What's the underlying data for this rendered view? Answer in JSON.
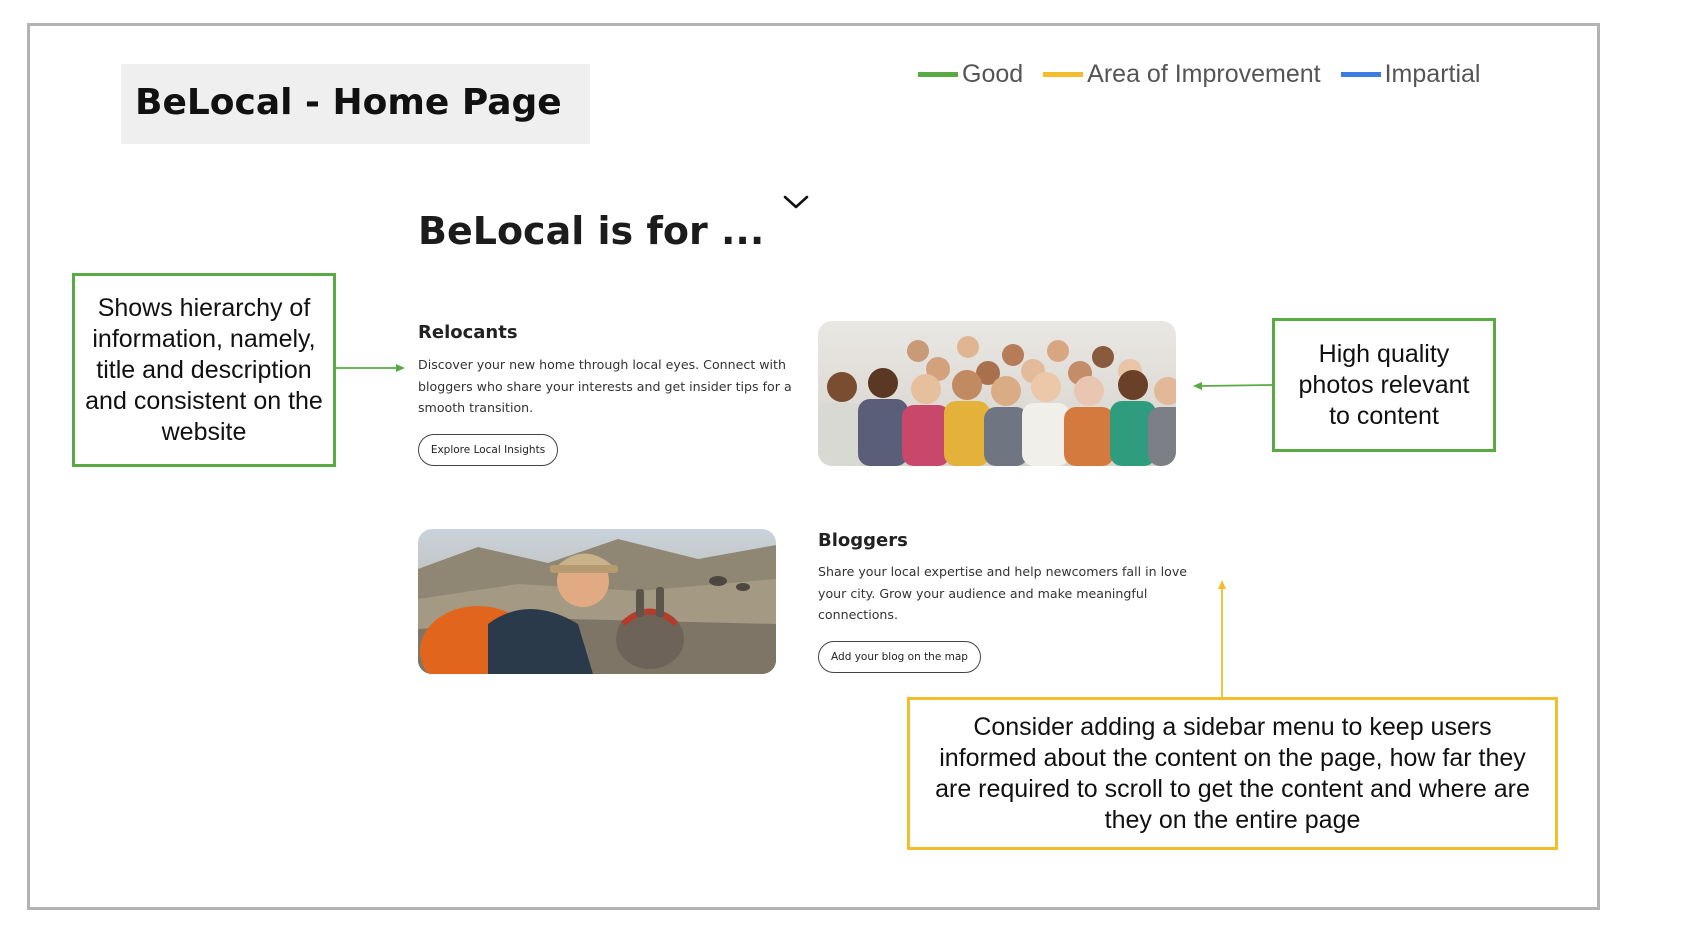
{
  "slide_title": "BeLocal - Home Page",
  "legend": [
    {
      "label": "Good",
      "color": "#5aaa44"
    },
    {
      "label": "Area of Improvement",
      "color": "#f3bd2c"
    },
    {
      "label": "Impartial",
      "color": "#3d7be2"
    }
  ],
  "section": {
    "heading": "BeLocal is for ...",
    "chevron_icon": "chevron-down-icon"
  },
  "relocants": {
    "title": "Relocants",
    "description": "Discover your new home through local eyes. Connect with bloggers who share your interests and get insider tips for a smooth transition.",
    "button": "Explore Local Insights",
    "image": "group-of-diverse-people-photo"
  },
  "bloggers": {
    "title": "Bloggers",
    "description": "Share your local expertise and help newcomers fall in love your city. Grow your audience and make meaningful connections.",
    "button": "Add your blog on the map",
    "image": "hiker-selfie-with-donkey-photo"
  },
  "annotations": {
    "hierarchy": {
      "text": "Shows hierarchy of information, namely, title and description and consistent on the website",
      "color": "#5aaa44"
    },
    "photos": {
      "text": "High quality photos relevant to content",
      "color": "#5aaa44"
    },
    "sidebar": {
      "text": "Consider adding a sidebar menu to keep users informed about the content on the page, how far they are required to scroll to get the content and where are they on the entire page",
      "color": "#f3bd2c"
    }
  }
}
